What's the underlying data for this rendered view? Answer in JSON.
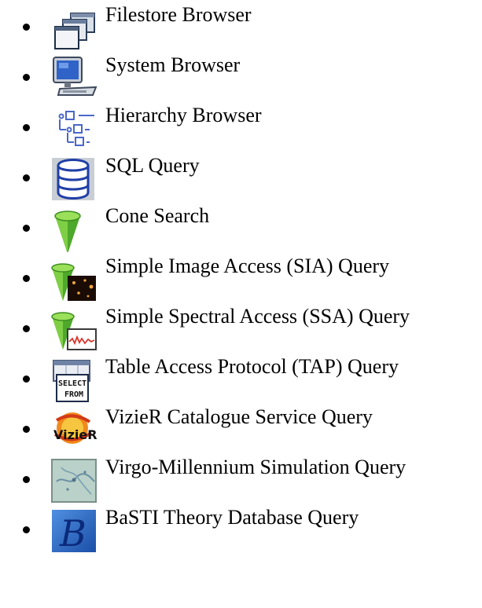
{
  "items": [
    {
      "label": "Filestore Browser",
      "icon": "filestore-folder-icon"
    },
    {
      "label": "System Browser",
      "icon": "computer-monitor-icon"
    },
    {
      "label": "Hierarchy Browser",
      "icon": "tree-hierarchy-icon"
    },
    {
      "label": "SQL Query",
      "icon": "database-icon"
    },
    {
      "label": "Cone Search",
      "icon": "cone-icon"
    },
    {
      "label": "Simple Image Access (SIA) Query",
      "icon": "cone-image-icon"
    },
    {
      "label": "Simple Spectral Access (SSA) Query",
      "icon": "cone-spectrum-icon"
    },
    {
      "label": "Table Access Protocol (TAP) Query",
      "icon": "select-from-table-icon"
    },
    {
      "label": "VizieR Catalogue Service Query",
      "icon": "vizier-logo-icon"
    },
    {
      "label": "Virgo-Millennium Simulation Query",
      "icon": "millennium-simulation-icon"
    },
    {
      "label": "BaSTI Theory Database Query",
      "icon": "basti-logo-icon"
    }
  ]
}
